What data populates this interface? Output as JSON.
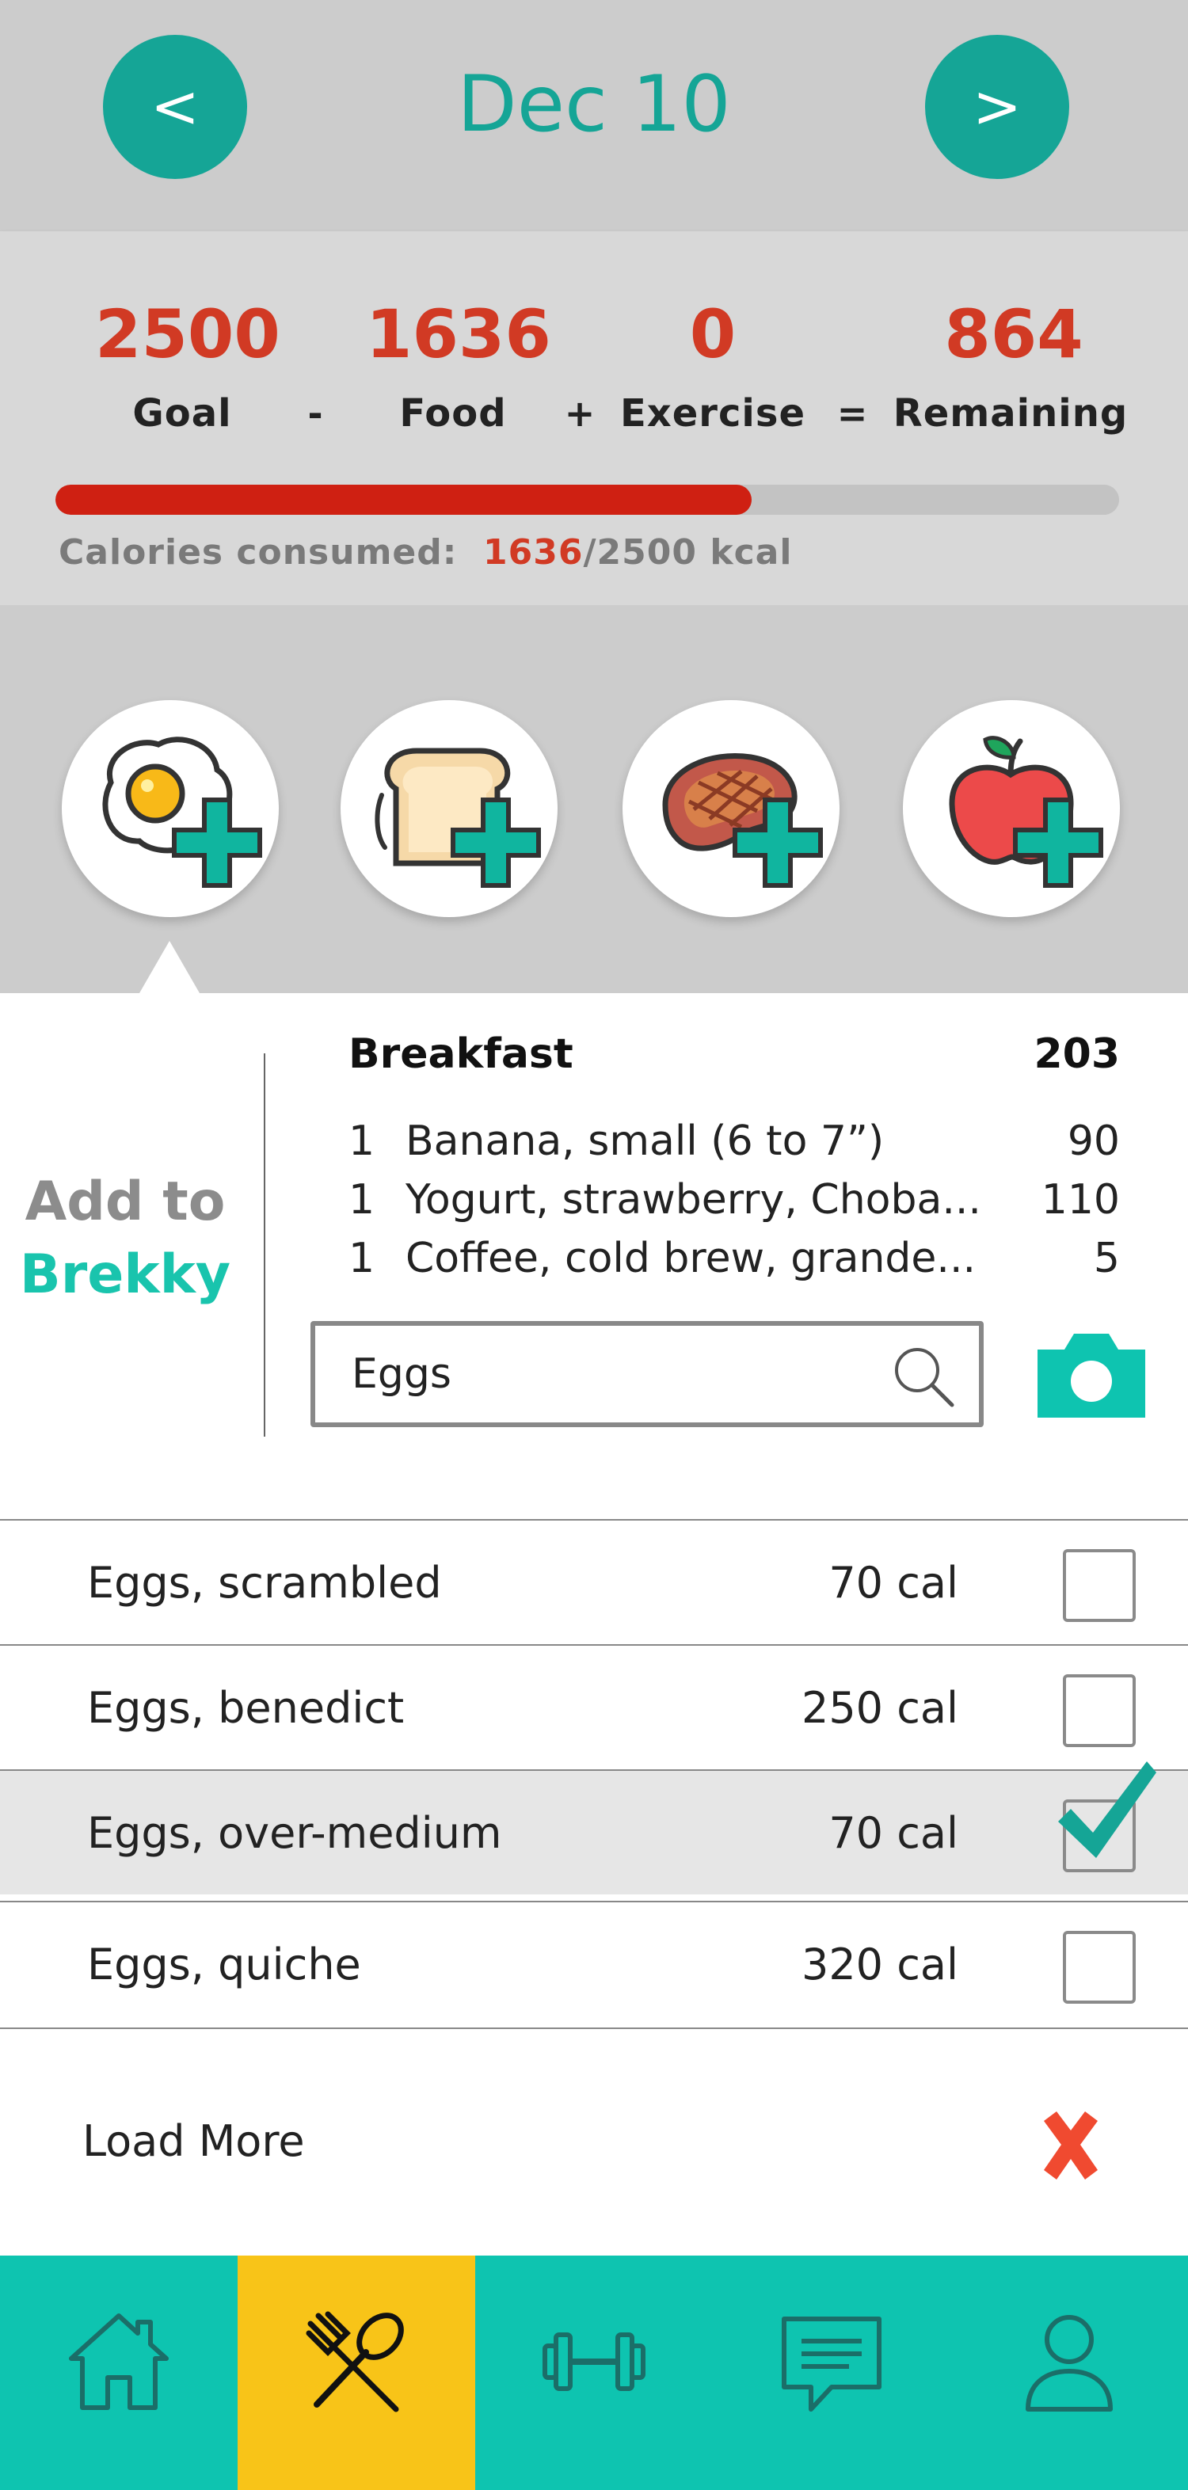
{
  "header": {
    "prev_label": "<",
    "next_label": ">",
    "date": "Dec 10"
  },
  "summary": {
    "goal": "2500",
    "food": "1636",
    "exercise": "0",
    "remaining": "864",
    "goal_label": "Goal",
    "food_label": "Food",
    "exercise_label": "Exercise",
    "remaining_label": "Remaining",
    "op_minus": "-",
    "op_plus": "+",
    "op_equals": "=",
    "consumed_prefix": "Calories consumed:",
    "consumed_value": "1636",
    "consumed_suffix": "/2500 kcal",
    "progress_fraction": 0.6544
  },
  "meal_buttons": [
    {
      "icon": "fried-egg-add-icon",
      "meal": "breakfast"
    },
    {
      "icon": "toast-add-icon",
      "meal": "lunch"
    },
    {
      "icon": "steak-add-icon",
      "meal": "dinner"
    },
    {
      "icon": "apple-add-icon",
      "meal": "snack"
    }
  ],
  "panel": {
    "add_to_line1": "Add to",
    "add_to_line2": "Brekky",
    "meal_title": "Breakfast",
    "meal_total": "203",
    "entries": [
      {
        "qty": "1",
        "name": "Banana, small (6 to 7”)",
        "cal": "90"
      },
      {
        "qty": "1",
        "name": "Yogurt, strawberry, Choba...",
        "cal": "110"
      },
      {
        "qty": "1",
        "name": "Coffee, cold brew, grande...",
        "cal": "5"
      }
    ],
    "search_value": "Eggs",
    "camera_icon": "camera-icon"
  },
  "results": [
    {
      "name": "Eggs, scrambled",
      "cal": "70 cal",
      "checked": false
    },
    {
      "name": "Eggs, benedict",
      "cal": "250 cal",
      "checked": false
    },
    {
      "name": "Eggs, over-medium",
      "cal": "70 cal",
      "checked": true
    },
    {
      "name": "Eggs, quiche",
      "cal": "320 cal",
      "checked": false
    }
  ],
  "load_more": "Load More",
  "tabs": [
    {
      "icon": "home-icon",
      "active": false
    },
    {
      "icon": "fork-spoon-icon",
      "active": true
    },
    {
      "icon": "dumbbell-icon",
      "active": false
    },
    {
      "icon": "chat-icon",
      "active": false
    },
    {
      "icon": "profile-icon",
      "active": false
    }
  ],
  "colors": {
    "teal": "#15a596",
    "accent_teal": "#0ec4b0",
    "red": "#d13a24",
    "yellow": "#f8c418"
  }
}
